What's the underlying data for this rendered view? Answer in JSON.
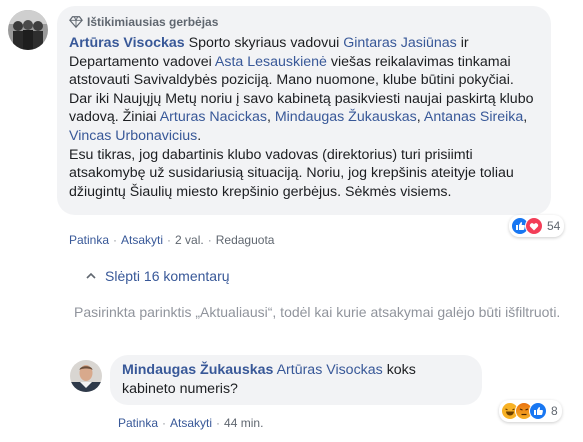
{
  "comment": {
    "badge": "Ištikimiausias gerbėjas",
    "author": "Artūras Visockas",
    "segments": [
      {
        "text": " Sporto skyriaus vadovui ",
        "type": "text"
      },
      {
        "text": "Gintaras Jasiūnas",
        "type": "mention"
      },
      {
        "text": " ir Departamento vadovei ",
        "type": "text"
      },
      {
        "text": "Asta Lesauskienė",
        "type": "mention"
      },
      {
        "text": " viešas reikalavimas tinkamai atstovauti Savivaldybės poziciją. Mano nuomone, klube būtini pokyčiai. Dar iki Naujųjų Metų noriu į savo kabinetą pasikviesti naujai paskirtą klubo vadovą. Žiniai ",
        "type": "text"
      },
      {
        "text": "Arturas Nacickas",
        "type": "mention"
      },
      {
        "text": ", ",
        "type": "text"
      },
      {
        "text": "Mindaugas Žukauskas",
        "type": "mention"
      },
      {
        "text": ", ",
        "type": "text"
      },
      {
        "text": "Antanas Sireika",
        "type": "mention"
      },
      {
        "text": ", ",
        "type": "text"
      },
      {
        "text": "Vincas Urbonavicius",
        "type": "mention"
      },
      {
        "text": ".",
        "type": "text"
      }
    ],
    "paragraph2": "Esu tikras, jog dabartinis klubo vadovas (direktorius) turi prisiimti atsakomybę už susidariusią situaciją. Noriu, jog krepšinis ateityje toliau džiugintų Šiaulių miesto krepšinio gerbėjus. Sėkmės visiems.",
    "actions": {
      "like": "Patinka",
      "reply": "Atsakyti",
      "time": "2 val.",
      "edited": "Redaguota"
    },
    "reactions": {
      "count": "54",
      "types": [
        "like-icon",
        "love-icon"
      ]
    }
  },
  "hide_replies": "Slėpti 16 komentarų",
  "filter_note": "Pasirinkta parinktis „Aktualiausi“, todėl kai kurie atsakymai galėjo būti išfiltruoti.",
  "reply": {
    "author": "Mindaugas Žukauskas",
    "mention": "Artūras Visockas",
    "text": " koks kabineto numeris?",
    "actions": {
      "like": "Patinka",
      "reply": "Atsakyti",
      "time": "44 min."
    },
    "reactions": {
      "count": "8",
      "types": [
        "haha-icon",
        "angry-icon",
        "like-icon"
      ]
    }
  },
  "colors": {
    "link": "#385898",
    "bubble": "#f2f3f5",
    "meta": "#606770",
    "like": "#1877f2",
    "love": "#f33e58",
    "haha": "#f7b125",
    "angry": "#e9710f"
  }
}
